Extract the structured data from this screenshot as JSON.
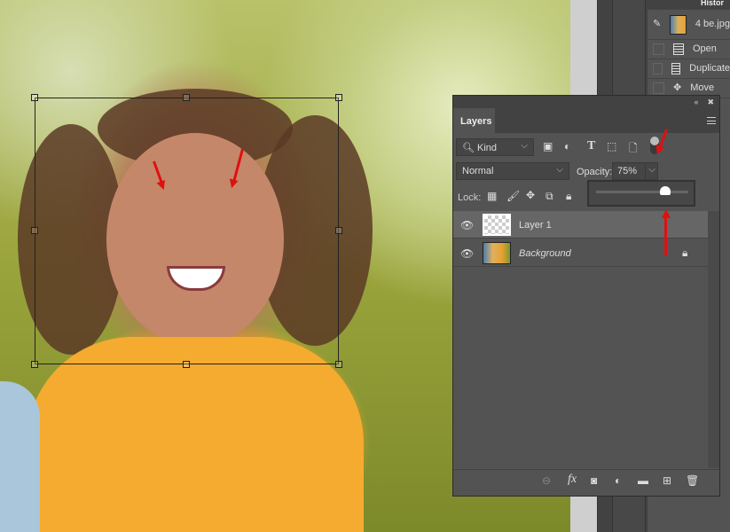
{
  "history": {
    "tab_label": "Histor",
    "doc_name": "4 be.jpg",
    "items": [
      {
        "label": "Open"
      },
      {
        "label": "Duplicate"
      },
      {
        "label": "Move"
      }
    ]
  },
  "layers": {
    "tab_label": "Layers",
    "filter_kind": "Kind",
    "blend_mode": "Normal",
    "opacity_label": "Opacity:",
    "opacity_value": "75%",
    "opacity_fraction": 0.75,
    "lock_label": "Lock:",
    "items": [
      {
        "name": "Layer 1",
        "selected": true,
        "locked": false
      },
      {
        "name": "Background",
        "selected": false,
        "locked": true
      }
    ]
  },
  "colors": {
    "annotation": "#e01010",
    "panel": "#535353",
    "selected_row": "#666666"
  }
}
